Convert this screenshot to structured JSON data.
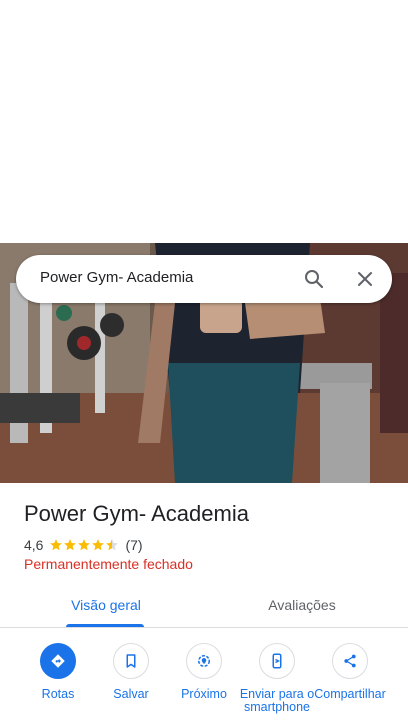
{
  "search": {
    "query": "Power Gym- Academia"
  },
  "place": {
    "name": "Power Gym- Academia",
    "rating": "4,6",
    "stars": 4.5,
    "review_count": "(7)",
    "status": "Permanentemente fechado"
  },
  "tabs": [
    {
      "label": "Visão geral",
      "selected": true
    },
    {
      "label": "Avaliações",
      "selected": false
    }
  ],
  "actions": [
    {
      "label": "Rotas",
      "icon": "directions-icon"
    },
    {
      "label": "Salvar",
      "icon": "bookmark-icon"
    },
    {
      "label": "Próximo",
      "icon": "nearby-icon"
    },
    {
      "label": "Enviar para o smartphone",
      "icon": "send-to-phone-icon"
    },
    {
      "label": "Compartilhar",
      "icon": "share-icon"
    }
  ],
  "colors": {
    "accent": "#1a73e8",
    "closed_status": "#d93025",
    "star": "#fbbc04"
  }
}
